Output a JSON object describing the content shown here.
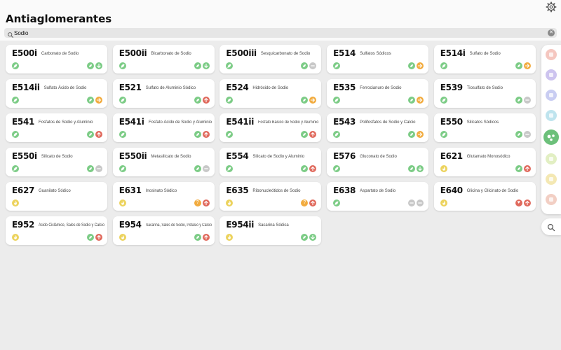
{
  "header": {
    "title": "Antiaglomerantes"
  },
  "search": {
    "value": "Sodio",
    "placeholder": ""
  },
  "colors": {
    "green": "#7ccc86",
    "yellow": "#ecd35e",
    "orange": "#f2ac40",
    "red": "#e06a5d",
    "gray": "#c8c8c8",
    "sidebar_green": "#6cc07a"
  },
  "additives": [
    {
      "code": "E500i",
      "name": "Carbonato de Sodio",
      "cat": "green",
      "b1": "green",
      "b2": "green"
    },
    {
      "code": "E500ii",
      "name": "Bicarbonato de Sodio",
      "cat": "green",
      "b1": "green",
      "b2": "green"
    },
    {
      "code": "E500iii",
      "name": "Sesquicarbonato de Sodio",
      "cat": "green",
      "b1": "green",
      "b2": "gray"
    },
    {
      "code": "E514",
      "name": "Sulfatos Sódicos",
      "cat": "green",
      "b1": "green",
      "b2": "orange"
    },
    {
      "code": "E514i",
      "name": "Sulfato de Sodio",
      "cat": "green",
      "b1": "green",
      "b2": "orange"
    },
    {
      "code": "E514ii",
      "name": "Sulfato Ácido de Sodio",
      "cat": "green",
      "b1": "green",
      "b2": "orange"
    },
    {
      "code": "E521",
      "name": "Sulfato de Aluminio Sódico",
      "cat": "green",
      "b1": "green",
      "b2": "red"
    },
    {
      "code": "E524",
      "name": "Hidróxido de Sodio",
      "cat": "green",
      "b1": "green",
      "b2": "orange"
    },
    {
      "code": "E535",
      "name": "Ferrocianuro de Sodio",
      "cat": "green",
      "b1": "green",
      "b2": "orange"
    },
    {
      "code": "E539",
      "name": "Tiosulfato de Sodio",
      "cat": "green",
      "b1": "green",
      "b2": "gray"
    },
    {
      "code": "E541",
      "name": "Fosfatos de Sodio y Aluminio",
      "cat": "green",
      "b1": "green",
      "b2": "red"
    },
    {
      "code": "E541i",
      "name": "Fosfato Ácido de Sodio y Aluminio",
      "cat": "green",
      "b1": "green",
      "b2": "red"
    },
    {
      "code": "E541ii",
      "name": "Fosfato Básico de Sodio y Aluminio",
      "cat": "green",
      "b1": "green",
      "b2": "red"
    },
    {
      "code": "E543",
      "name": "Polifosfatos de Sodio y Calcio",
      "cat": "green",
      "b1": "green",
      "b2": "orange"
    },
    {
      "code": "E550",
      "name": "Silicatos Sódicos",
      "cat": "green",
      "b1": "green",
      "b2": "gray"
    },
    {
      "code": "E550i",
      "name": "Silicato de Sodio",
      "cat": "green",
      "b1": "green",
      "b2": "gray"
    },
    {
      "code": "E550ii",
      "name": "Metasilicato de Sodio",
      "cat": "green",
      "b1": "green",
      "b2": "gray"
    },
    {
      "code": "E554",
      "name": "Silicato de Sodio y Aluminio",
      "cat": "green",
      "b1": "green",
      "b2": "red"
    },
    {
      "code": "E576",
      "name": "Gluconato de Sodio",
      "cat": "green",
      "b1": "green",
      "b2": "green"
    },
    {
      "code": "E621",
      "name": "Glutamato Monosódico",
      "cat": "yellow",
      "b1": "green",
      "b2": "red"
    },
    {
      "code": "E627",
      "name": "Guanilato Sódico",
      "cat": "yellow",
      "b1": "",
      "b2": ""
    },
    {
      "code": "E631",
      "name": "Inosinato Sódico",
      "cat": "yellow",
      "b1": "orange",
      "b2": "red"
    },
    {
      "code": "E635",
      "name": "Ribonucleótidos de Sodio",
      "cat": "yellow",
      "b1": "orange",
      "b2": "red"
    },
    {
      "code": "E638",
      "name": "Aspartato de Sodio",
      "cat": "green",
      "b1": "gray",
      "b2": "gray"
    },
    {
      "code": "E640",
      "name": "Glicina y Glicinato de Sodio",
      "cat": "yellow",
      "b1": "red",
      "b2": "red"
    },
    {
      "code": "E952",
      "name": "Ácido Ciclámico, Sales de Sodio y Calcio",
      "cat": "yellow",
      "b1": "green",
      "b2": "red"
    },
    {
      "code": "E954",
      "name": "Sacarina, Sales de Sodio, Potasio y Calcio",
      "cat": "yellow",
      "b1": "green",
      "b2": "red"
    },
    {
      "code": "E954ii",
      "name": "Sacarina Sódica",
      "cat": "yellow",
      "b1": "green",
      "b2": "green"
    }
  ],
  "sidebar": {
    "items": [
      {
        "icon": "pills-icon",
        "color": "#f5c7c0"
      },
      {
        "icon": "list-icon",
        "color": "#cdc4ef"
      },
      {
        "icon": "clock-icon",
        "color": "#c9cdf2"
      },
      {
        "icon": "leaf-icon",
        "color": "#bfe4ee"
      },
      {
        "icon": "dots-icon",
        "color": "#6cc07a"
      },
      {
        "icon": "drop-icon",
        "color": "#e2efc3"
      },
      {
        "icon": "flame-icon",
        "color": "#f4e8b3"
      },
      {
        "icon": "cake-icon",
        "color": "#f2cfc4"
      }
    ]
  }
}
